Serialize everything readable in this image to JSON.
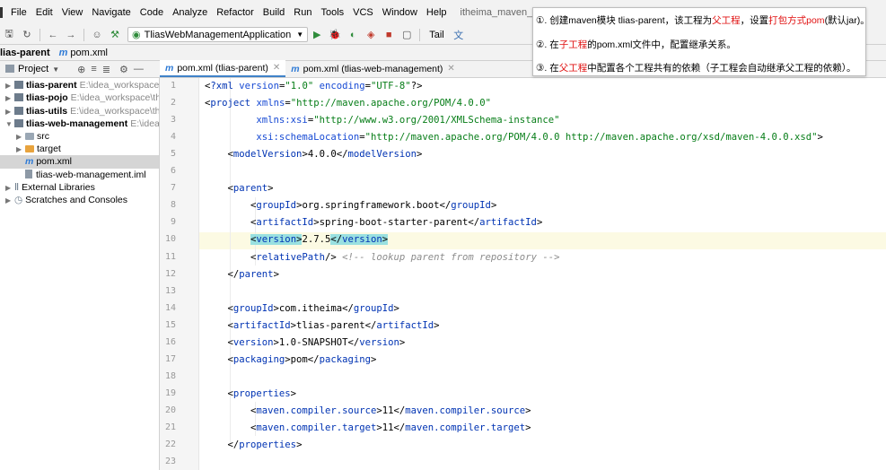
{
  "menubar": {
    "items": [
      "File",
      "Edit",
      "View",
      "Navigate",
      "Code",
      "Analyze",
      "Refactor",
      "Build",
      "Run",
      "Tools",
      "VCS",
      "Window",
      "Help"
    ],
    "title": "itheima_maven_project - pom.xml (tli"
  },
  "toolbar": {
    "run_config": "TliasWebManagementApplication",
    "tail_label": "Tail"
  },
  "navbar": {
    "project": "lias-parent",
    "file": "pom.xml"
  },
  "project_panel": {
    "title": "Project",
    "tree": [
      {
        "name": "tlias-parent",
        "path": "E:\\idea_workspace\\ithe"
      },
      {
        "name": "tlias-pojo",
        "path": "E:\\idea_workspace\\theim"
      },
      {
        "name": "tlias-utils",
        "path": "E:\\idea_workspace\\theim"
      },
      {
        "name": "tlias-web-management",
        "path": "E:\\idea_wo"
      },
      {
        "name": "src"
      },
      {
        "name": "target"
      },
      {
        "name": "pom.xml"
      },
      {
        "name": "tlias-web-management.iml"
      },
      {
        "name": "External Libraries"
      },
      {
        "name": "Scratches and Consoles"
      }
    ]
  },
  "tabs": [
    {
      "label": "pom.xml (tlias-parent)"
    },
    {
      "label": "pom.xml (tlias-web-management)"
    }
  ],
  "editor": {
    "line_numbers": [
      "1",
      "2",
      "3",
      "4",
      "5",
      "6",
      "7",
      "8",
      "9",
      "10",
      "11",
      "12",
      "13",
      "14",
      "15",
      "16",
      "17",
      "18",
      "19",
      "20",
      "21",
      "22",
      "23"
    ],
    "lines": [
      "<?xml version=\"1.0\" encoding=\"UTF-8\"?>",
      "<project xmlns=\"http://maven.apache.org/POM/4.0.0\"",
      "         xmlns:xsi=\"http://www.w3.org/2001/XMLSchema-instance\"",
      "         xsi:schemaLocation=\"http://maven.apache.org/POM/4.0.0 http://maven.apache.org/xsd/maven-4.0.0.xsd\">",
      "    <modelVersion>4.0.0</modelVersion>",
      "",
      "    <parent>",
      "        <groupId>org.springframework.boot</groupId>",
      "        <artifactId>spring-boot-starter-parent</artifactId>",
      "        <version>2.7.5</version>",
      "        <relativePath/> <!-- lookup parent from repository -->",
      "    </parent>",
      "",
      "    <groupId>com.itheima</groupId>",
      "    <artifactId>tlias-parent</artifactId>",
      "    <version>1.0-SNAPSHOT</version>",
      "    <packaging>pom</packaging>",
      "",
      "    <properties>",
      "        <maven.compiler.source>11</maven.compiler.source>",
      "        <maven.compiler.target>11</maven.compiler.target>",
      "    </properties>",
      ""
    ]
  },
  "popup": {
    "line1": [
      "①. 创建maven模块 tlias-parent，该工程为",
      "父工程",
      "，设置",
      "打包方式pom",
      "(默认jar)。"
    ],
    "line2": [
      "②. 在",
      "子工程",
      "的pom.xml文件中，配置继承关系。"
    ],
    "line3": [
      "③. 在",
      "父工程",
      "中配置各个工程共有的依赖（子工程会自动继承父工程的依赖）。"
    ]
  },
  "colors": {
    "tag": "#0033b3",
    "value": "#067d17",
    "comment": "#8c8c8c",
    "accent_red": "#e01010"
  }
}
